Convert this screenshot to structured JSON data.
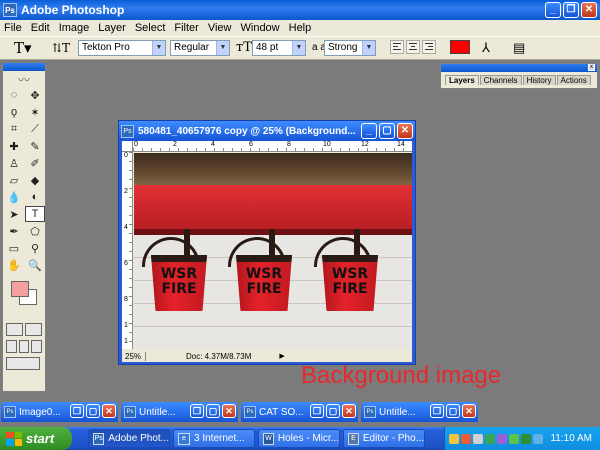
{
  "app": {
    "title": "Adobe Photoshop",
    "icon_text": "Ps"
  },
  "menu": [
    "File",
    "Edit",
    "Image",
    "Layer",
    "Select",
    "Filter",
    "View",
    "Window",
    "Help"
  ],
  "options": {
    "font_family": "Tekton Pro",
    "font_style": "Regular",
    "font_size": "48 pt",
    "aa_label": "a a",
    "antialias": "Strong",
    "text_color": "#ff0000"
  },
  "palette": {
    "tabs": [
      "Layers",
      "Channels",
      "History",
      "Actions"
    ]
  },
  "toolbox": {
    "foreground_color": "#f4a0a0",
    "background_color": "#ffffff",
    "tools": [
      "marquee",
      "move",
      "lasso",
      "magic-wand",
      "crop",
      "slice",
      "healing",
      "brush",
      "clone-stamp",
      "history-brush",
      "eraser",
      "paint-bucket",
      "blur",
      "dodge",
      "path-select",
      "type",
      "pen",
      "shape",
      "notes",
      "eyedropper",
      "hand",
      "zoom"
    ]
  },
  "document": {
    "title": "580481_40657976 copy @ 25% (Background...",
    "zoom": "25%",
    "doc_info": "Doc: 4.37M/8.73M",
    "ruler_top": [
      "0",
      "2",
      "4",
      "6",
      "8",
      "10",
      "12",
      "14"
    ],
    "ruler_left": [
      "0",
      "2",
      "4",
      "6",
      "8",
      "1",
      "1"
    ],
    "buckets": [
      {
        "line1": "WSR",
        "line2": "FIRE"
      },
      {
        "line1": "WSR",
        "line2": "FIRE"
      },
      {
        "line1": "WSR",
        "line2": "FIRE"
      }
    ]
  },
  "annotation": "Background image",
  "minimized": [
    {
      "title": "Image0..."
    },
    {
      "title": "Untitle..."
    },
    {
      "title": "CAT SO..."
    },
    {
      "title": "Untitle..."
    }
  ],
  "taskbar": {
    "start": "start",
    "tasks": [
      {
        "label": "Adobe Phot...",
        "active": true
      },
      {
        "label": "3 Internet...",
        "active": false
      },
      {
        "label": "Holes - Micr...",
        "active": false
      },
      {
        "label": "Editor - Pho...",
        "active": false
      }
    ],
    "clock": "11:10 AM"
  }
}
